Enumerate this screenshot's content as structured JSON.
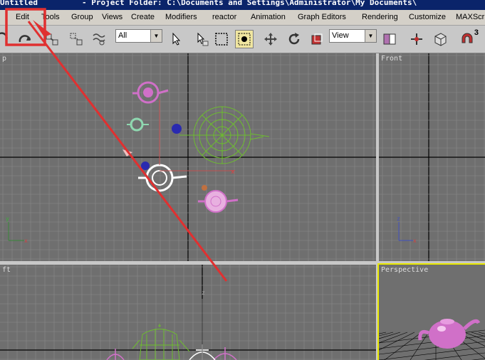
{
  "window": {
    "title": "Untitled",
    "project_folder": "- Project Folder: C:\\Documents and Settings\\Administrator\\My Documents\\"
  },
  "menu": [
    "Edit",
    "Tools",
    "Group",
    "Views",
    "Create",
    "Modifiers",
    "reactor",
    "Animation",
    "Graph Editors",
    "Rendering",
    "Customize",
    "MAXScri"
  ],
  "toolbar": {
    "selection_filter": "All",
    "reference_coord": "View",
    "snap_label": "3"
  },
  "viewports": {
    "top": "p",
    "front": "Front",
    "left": "ft",
    "perspective": "Perspective"
  },
  "colors": {
    "viewport_bg": "#6f6f6f",
    "grid": "#8a8a8a",
    "active_viewport_border": "#e8e800",
    "annotation_red": "#e03030",
    "teapot_pink": "#d070c8",
    "teapot_green": "#6dbd2f"
  }
}
